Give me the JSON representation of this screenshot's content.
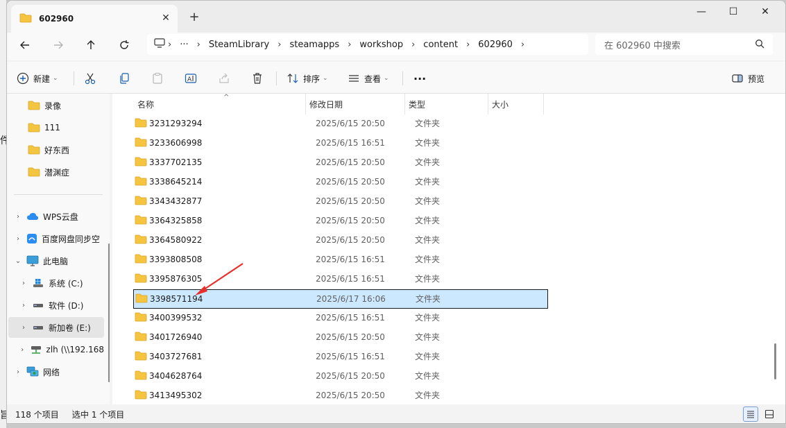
{
  "window": {
    "tab_title": "602960",
    "close_tab": "✕",
    "new_tab": "+",
    "minimize": "—",
    "maximize": "☐",
    "close": "✕"
  },
  "nav": {
    "breadcrumbs": [
      "SteamLibrary",
      "steamapps",
      "workshop",
      "content",
      "602960"
    ],
    "more": "···",
    "search_placeholder": "在 602960 中搜索"
  },
  "toolbar": {
    "new_label": "新建",
    "sort_label": "排序",
    "view_label": "查看",
    "more_label": "···",
    "preview_label": "预览"
  },
  "sidebar": {
    "quick_items": [
      {
        "label": "录像"
      },
      {
        "label": "111"
      },
      {
        "label": "好东西"
      },
      {
        "label": "潜渊症"
      }
    ],
    "tree_items": [
      {
        "label": "WPS云盘",
        "icon": "cloud-icon"
      },
      {
        "label": "百度网盘同步空",
        "icon": "baidu-netdisk-icon"
      },
      {
        "label": "此电脑",
        "icon": "computer-icon"
      },
      {
        "label": "系统 (C:)",
        "icon": "windows-drive-icon"
      },
      {
        "label": "软件 (D:)",
        "icon": "drive-icon"
      },
      {
        "label": "新加卷 (E:)",
        "icon": "drive-icon"
      },
      {
        "label": "zlh (\\\\192.168",
        "icon": "network-drive-icon"
      },
      {
        "label": "网络",
        "icon": "network-icon"
      }
    ],
    "edge_chars": [
      "件",
      "旨"
    ]
  },
  "columns": {
    "name": "名称",
    "modified": "修改日期",
    "type": "类型",
    "size": "大小"
  },
  "files": [
    {
      "name": "3231293294",
      "modified": "2025/6/15 20:50",
      "type": "文件夹"
    },
    {
      "name": "3233606998",
      "modified": "2025/6/15 16:51",
      "type": "文件夹"
    },
    {
      "name": "3337702135",
      "modified": "2025/6/15 20:50",
      "type": "文件夹"
    },
    {
      "name": "3338645214",
      "modified": "2025/6/15 20:50",
      "type": "文件夹"
    },
    {
      "name": "3343432877",
      "modified": "2025/6/15 20:50",
      "type": "文件夹"
    },
    {
      "name": "3364325858",
      "modified": "2025/6/15 20:50",
      "type": "文件夹"
    },
    {
      "name": "3364580922",
      "modified": "2025/6/15 20:50",
      "type": "文件夹"
    },
    {
      "name": "3393808508",
      "modified": "2025/6/15 16:51",
      "type": "文件夹"
    },
    {
      "name": "3395876305",
      "modified": "2025/6/15 16:51",
      "type": "文件夹"
    },
    {
      "name": "3398571194",
      "modified": "2025/6/17 16:06",
      "type": "文件夹",
      "selected": true
    },
    {
      "name": "3400399532",
      "modified": "2025/6/15 16:51",
      "type": "文件夹"
    },
    {
      "name": "3401726940",
      "modified": "2025/6/15 20:50",
      "type": "文件夹"
    },
    {
      "name": "3403727681",
      "modified": "2025/6/15 16:51",
      "type": "文件夹"
    },
    {
      "name": "3404628764",
      "modified": "2025/6/15 20:50",
      "type": "文件夹"
    },
    {
      "name": "3413495302",
      "modified": "2025/6/15 20:50",
      "type": "文件夹"
    }
  ],
  "status": {
    "count": "118 个项目",
    "selected": "选中 1 个项目"
  },
  "colors": {
    "folder": "#f5c542",
    "selection": "#cce8ff",
    "annotation_arrow": "#e8302a"
  }
}
